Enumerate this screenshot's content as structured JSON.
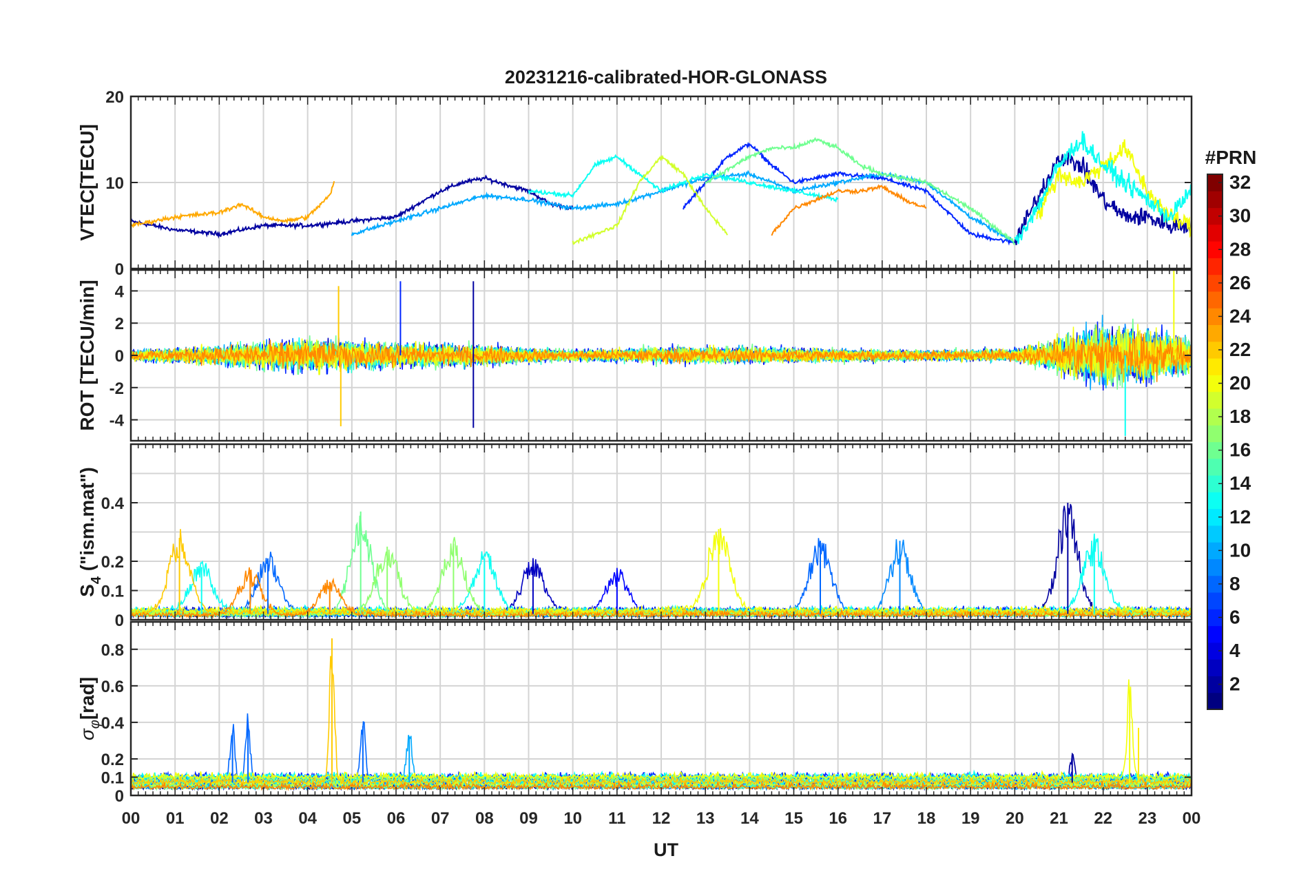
{
  "figure": {
    "title": "20231216-calibrated-HOR-GLONASS",
    "xlabel": "UT"
  },
  "chart_data": [
    {
      "type": "line",
      "title": "20231216-calibrated-HOR-GLONASS",
      "ylabel": "VTEC[TECU]",
      "ylim": [
        0,
        20
      ],
      "yticks": [
        "0",
        "10",
        "20"
      ],
      "xlim": [
        0,
        24
      ],
      "grid": true,
      "series_note": "approx. traced envelope",
      "series": [
        {
          "prn": 2,
          "x": [
            0,
            1,
            2,
            3,
            4,
            5,
            6,
            7,
            7.5,
            8,
            9,
            9.5,
            10
          ],
          "y": [
            5.5,
            4.5,
            4,
            5,
            5,
            5.5,
            6,
            9,
            10,
            10.5,
            9,
            7.5,
            7
          ]
        },
        {
          "prn": 6,
          "x": [
            12.5,
            13,
            13.5,
            14,
            14.5,
            15,
            16,
            17,
            18,
            19,
            20
          ],
          "y": [
            7,
            10,
            13,
            14.5,
            12,
            10,
            11,
            10.5,
            9,
            4,
            3
          ]
        },
        {
          "prn": 10,
          "x": [
            5,
            6,
            7,
            8,
            9,
            10,
            11,
            12,
            13,
            14,
            15,
            16,
            17,
            18,
            19,
            20
          ],
          "y": [
            4,
            5.5,
            7,
            8.5,
            8,
            7,
            7.5,
            9,
            10.5,
            11,
            9,
            10,
            11,
            10,
            6,
            3
          ]
        },
        {
          "prn": 13,
          "x": [
            9,
            10,
            10.5,
            11,
            11.5,
            12,
            13,
            14,
            15,
            16
          ],
          "y": [
            9,
            8.5,
            12,
            13,
            11,
            9,
            11,
            10,
            9,
            8
          ]
        },
        {
          "prn": 16,
          "x": [
            13,
            14,
            14.5,
            15,
            15.5,
            16,
            16.5,
            17,
            18,
            19,
            20
          ],
          "y": [
            10,
            13,
            14,
            14,
            15,
            14,
            12,
            11,
            10,
            7,
            3
          ]
        },
        {
          "prn": 19,
          "x": [
            10,
            11,
            11.5,
            12,
            12.5,
            13,
            13.5
          ],
          "y": [
            3,
            5,
            10,
            13,
            11,
            7,
            4
          ]
        },
        {
          "prn": 23,
          "x": [
            0,
            1,
            2,
            2.5,
            3,
            3.5,
            4,
            4.5,
            4.6
          ],
          "y": [
            5,
            6,
            6.5,
            7.5,
            6,
            5.5,
            6,
            8.5,
            10
          ]
        },
        {
          "prn": 24,
          "x": [
            14.5,
            15,
            15.5,
            16,
            16.5,
            17,
            17.5,
            18
          ],
          "y": [
            4,
            7,
            8,
            9,
            9,
            9.5,
            8,
            7
          ]
        },
        {
          "prn": 2,
          "x": [
            20,
            20.5,
            21,
            21.5,
            22,
            22.5,
            23,
            23.5,
            24
          ],
          "y": [
            3,
            8,
            13,
            12,
            8,
            6,
            6,
            5,
            5
          ]
        },
        {
          "prn": 20,
          "x": [
            20.5,
            21,
            21.5,
            22,
            22.5,
            23,
            23.5,
            24
          ],
          "y": [
            6,
            11,
            10,
            12,
            14,
            9,
            6,
            5
          ]
        },
        {
          "prn": 13,
          "x": [
            20,
            20.5,
            21,
            21.5,
            22,
            22.5,
            23,
            23.5,
            24
          ],
          "y": [
            3,
            7,
            12,
            15,
            12,
            10,
            8,
            6,
            9
          ]
        }
      ]
    },
    {
      "type": "line",
      "ylabel": "ROT [TECU/min]",
      "ylim": [
        -5.3,
        5.3
      ],
      "yticks": [
        "-4",
        "-2",
        "0",
        "2",
        "4"
      ],
      "xlim": [
        0,
        24
      ],
      "grid": true,
      "series_note": "approx. noise envelope about zero; amplitude grows after 20 UT",
      "envelope": {
        "x": [
          0,
          2,
          4,
          6,
          8,
          10,
          12,
          14,
          16,
          18,
          20,
          21,
          22,
          23,
          24
        ],
        "amp": [
          0.8,
          1.5,
          2.5,
          1.8,
          1.5,
          0.8,
          1.2,
          1.2,
          1.0,
          0.8,
          1.0,
          2.5,
          4.5,
          4.0,
          2.5
        ]
      },
      "peaks": [
        {
          "x": 4.7,
          "y": 4.3,
          "prn": 22
        },
        {
          "x": 4.75,
          "y": -4.4,
          "prn": 22
        },
        {
          "x": 6.1,
          "y": 4.6,
          "prn": 6
        },
        {
          "x": 7.75,
          "y": 4.6,
          "prn": 2
        },
        {
          "x": 7.75,
          "y": -4.5,
          "prn": 2
        },
        {
          "x": 22.5,
          "y": -5.0,
          "prn": 13
        },
        {
          "x": 23.6,
          "y": 5.3,
          "prn": 20
        }
      ]
    },
    {
      "type": "line",
      "ylabel": "S4 (\"ism.mat\")",
      "ylim": [
        0,
        0.6
      ],
      "yticks": [
        "0",
        "0.1",
        "0.2",
        "0.4"
      ],
      "xlim": [
        0,
        24
      ],
      "grid": true,
      "series_note": "approx. traced peaks over a low baseline",
      "peaks": [
        {
          "x": 1.1,
          "y": 0.28,
          "prn": 22
        },
        {
          "x": 1.6,
          "y": 0.18,
          "prn": 13
        },
        {
          "x": 2.7,
          "y": 0.17,
          "prn": 24
        },
        {
          "x": 3.1,
          "y": 0.21,
          "prn": 8
        },
        {
          "x": 4.5,
          "y": 0.13,
          "prn": 24
        },
        {
          "x": 5.2,
          "y": 0.37,
          "prn": 16
        },
        {
          "x": 5.8,
          "y": 0.25,
          "prn": 17
        },
        {
          "x": 7.3,
          "y": 0.26,
          "prn": 17
        },
        {
          "x": 8.0,
          "y": 0.21,
          "prn": 13
        },
        {
          "x": 9.1,
          "y": 0.19,
          "prn": 3
        },
        {
          "x": 11.0,
          "y": 0.16,
          "prn": 5
        },
        {
          "x": 13.3,
          "y": 0.31,
          "prn": 20
        },
        {
          "x": 15.6,
          "y": 0.27,
          "prn": 8
        },
        {
          "x": 17.4,
          "y": 0.27,
          "prn": 9
        },
        {
          "x": 21.2,
          "y": 0.4,
          "prn": 2
        },
        {
          "x": 21.8,
          "y": 0.26,
          "prn": 13
        }
      ]
    },
    {
      "type": "line",
      "ylabel": "σφ[rad]",
      "ylim": [
        0,
        0.95
      ],
      "yticks": [
        "0",
        "0.1",
        "0.2",
        "0.4",
        "0.6",
        "0.8"
      ],
      "xlim": [
        0,
        24
      ],
      "xticks": [
        "00",
        "01",
        "02",
        "03",
        "04",
        "05",
        "06",
        "07",
        "08",
        "09",
        "10",
        "11",
        "12",
        "13",
        "14",
        "15",
        "16",
        "17",
        "18",
        "19",
        "20",
        "21",
        "22",
        "23",
        "00"
      ],
      "xlabel": "UT",
      "grid": true,
      "series_note": "approx. traced peaks over a ~0.1 rad baseline",
      "peaks": [
        {
          "x": 2.3,
          "y": 0.34,
          "prn": 8
        },
        {
          "x": 2.65,
          "y": 0.39,
          "prn": 8
        },
        {
          "x": 4.55,
          "y": 0.86,
          "prn": 22
        },
        {
          "x": 5.25,
          "y": 0.38,
          "prn": 8
        },
        {
          "x": 6.3,
          "y": 0.32,
          "prn": 10
        },
        {
          "x": 21.3,
          "y": 0.22,
          "prn": 2
        },
        {
          "x": 22.6,
          "y": 0.57,
          "prn": 20
        },
        {
          "x": 22.8,
          "y": 0.37,
          "prn": 21
        }
      ]
    }
  ],
  "colorbar": {
    "label": "#PRN",
    "min": 1,
    "max": 32,
    "ticks": [
      "2",
      "4",
      "6",
      "8",
      "10",
      "12",
      "14",
      "16",
      "18",
      "20",
      "22",
      "24",
      "26",
      "28",
      "30",
      "32"
    ],
    "colormap": "jet"
  }
}
